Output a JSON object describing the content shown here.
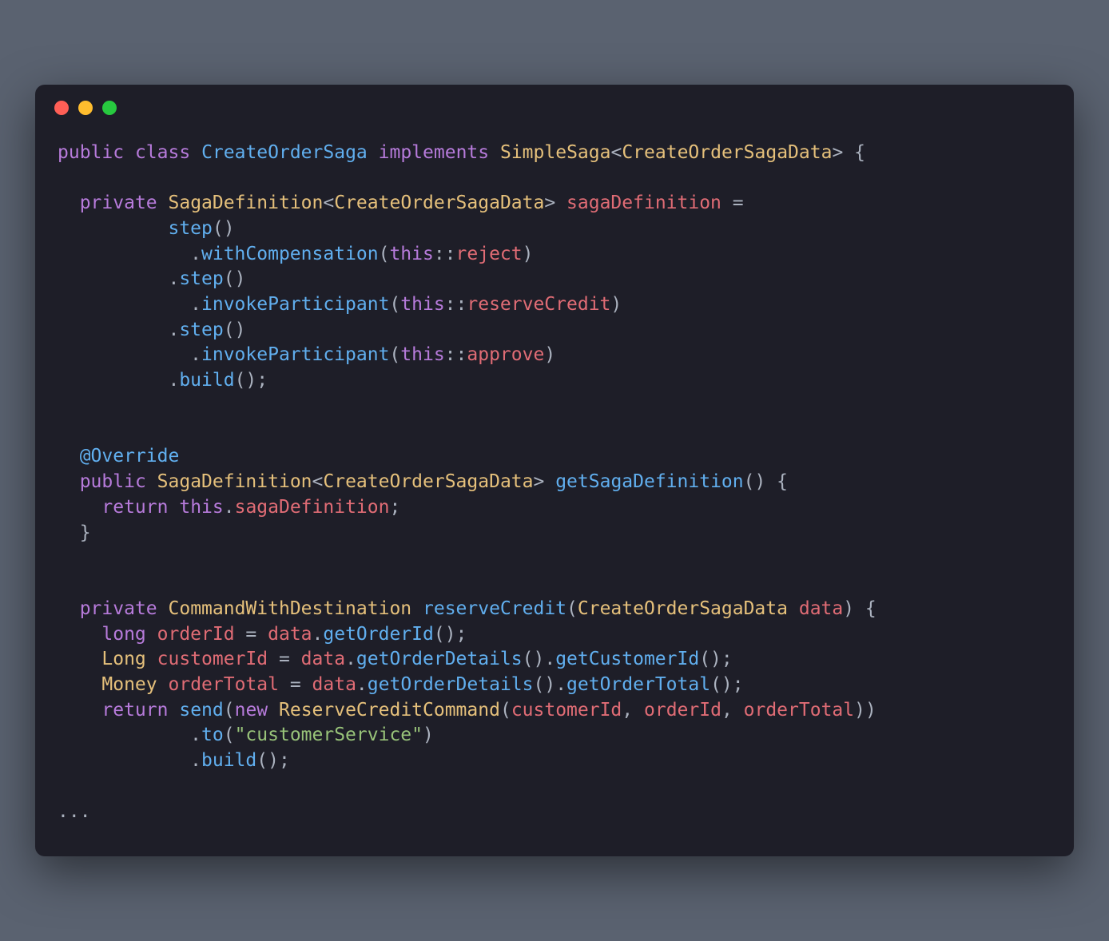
{
  "window": {
    "dots": [
      "red",
      "yellow",
      "green"
    ]
  },
  "code": {
    "tokens": [
      {
        "cls": "kw",
        "t": "public"
      },
      {
        "cls": "punc",
        "t": " "
      },
      {
        "cls": "kw",
        "t": "class"
      },
      {
        "cls": "punc",
        "t": " "
      },
      {
        "cls": "cls",
        "t": "CreateOrderSaga"
      },
      {
        "cls": "punc",
        "t": " "
      },
      {
        "cls": "kw",
        "t": "implements"
      },
      {
        "cls": "punc",
        "t": " "
      },
      {
        "cls": "type",
        "t": "SimpleSaga"
      },
      {
        "cls": "punc",
        "t": "<"
      },
      {
        "cls": "type",
        "t": "CreateOrderSagaData"
      },
      {
        "cls": "punc",
        "t": "> {"
      },
      {
        "cls": "punc",
        "t": "\n"
      },
      {
        "cls": "punc",
        "t": "\n"
      },
      {
        "cls": "punc",
        "t": "  "
      },
      {
        "cls": "kw",
        "t": "private"
      },
      {
        "cls": "punc",
        "t": " "
      },
      {
        "cls": "type",
        "t": "SagaDefinition"
      },
      {
        "cls": "punc",
        "t": "<"
      },
      {
        "cls": "type",
        "t": "CreateOrderSagaData"
      },
      {
        "cls": "punc",
        "t": "> "
      },
      {
        "cls": "var",
        "t": "sagaDefinition"
      },
      {
        "cls": "punc",
        "t": " ="
      },
      {
        "cls": "punc",
        "t": "\n"
      },
      {
        "cls": "punc",
        "t": "          "
      },
      {
        "cls": "method",
        "t": "step"
      },
      {
        "cls": "punc",
        "t": "()"
      },
      {
        "cls": "punc",
        "t": "\n"
      },
      {
        "cls": "punc",
        "t": "            ."
      },
      {
        "cls": "method",
        "t": "withCompensation"
      },
      {
        "cls": "punc",
        "t": "("
      },
      {
        "cls": "thiskw",
        "t": "this"
      },
      {
        "cls": "punc",
        "t": "::"
      },
      {
        "cls": "var",
        "t": "reject"
      },
      {
        "cls": "punc",
        "t": ")"
      },
      {
        "cls": "punc",
        "t": "\n"
      },
      {
        "cls": "punc",
        "t": "          ."
      },
      {
        "cls": "method",
        "t": "step"
      },
      {
        "cls": "punc",
        "t": "()"
      },
      {
        "cls": "punc",
        "t": "\n"
      },
      {
        "cls": "punc",
        "t": "            ."
      },
      {
        "cls": "method",
        "t": "invokeParticipant"
      },
      {
        "cls": "punc",
        "t": "("
      },
      {
        "cls": "thiskw",
        "t": "this"
      },
      {
        "cls": "punc",
        "t": "::"
      },
      {
        "cls": "var",
        "t": "reserveCredit"
      },
      {
        "cls": "punc",
        "t": ")"
      },
      {
        "cls": "punc",
        "t": "\n"
      },
      {
        "cls": "punc",
        "t": "          ."
      },
      {
        "cls": "method",
        "t": "step"
      },
      {
        "cls": "punc",
        "t": "()"
      },
      {
        "cls": "punc",
        "t": "\n"
      },
      {
        "cls": "punc",
        "t": "            ."
      },
      {
        "cls": "method",
        "t": "invokeParticipant"
      },
      {
        "cls": "punc",
        "t": "("
      },
      {
        "cls": "thiskw",
        "t": "this"
      },
      {
        "cls": "punc",
        "t": "::"
      },
      {
        "cls": "var",
        "t": "approve"
      },
      {
        "cls": "punc",
        "t": ")"
      },
      {
        "cls": "punc",
        "t": "\n"
      },
      {
        "cls": "punc",
        "t": "          ."
      },
      {
        "cls": "method",
        "t": "build"
      },
      {
        "cls": "punc",
        "t": "();"
      },
      {
        "cls": "punc",
        "t": "\n"
      },
      {
        "cls": "punc",
        "t": "\n"
      },
      {
        "cls": "punc",
        "t": "\n"
      },
      {
        "cls": "punc",
        "t": "  "
      },
      {
        "cls": "ann",
        "t": "@Override"
      },
      {
        "cls": "punc",
        "t": "\n"
      },
      {
        "cls": "punc",
        "t": "  "
      },
      {
        "cls": "kw",
        "t": "public"
      },
      {
        "cls": "punc",
        "t": " "
      },
      {
        "cls": "type",
        "t": "SagaDefinition"
      },
      {
        "cls": "punc",
        "t": "<"
      },
      {
        "cls": "type",
        "t": "CreateOrderSagaData"
      },
      {
        "cls": "punc",
        "t": "> "
      },
      {
        "cls": "method",
        "t": "getSagaDefinition"
      },
      {
        "cls": "punc",
        "t": "() {"
      },
      {
        "cls": "punc",
        "t": "\n"
      },
      {
        "cls": "punc",
        "t": "    "
      },
      {
        "cls": "kw",
        "t": "return"
      },
      {
        "cls": "punc",
        "t": " "
      },
      {
        "cls": "thiskw",
        "t": "this"
      },
      {
        "cls": "punc",
        "t": "."
      },
      {
        "cls": "var",
        "t": "sagaDefinition"
      },
      {
        "cls": "punc",
        "t": ";"
      },
      {
        "cls": "punc",
        "t": "\n"
      },
      {
        "cls": "punc",
        "t": "  }"
      },
      {
        "cls": "punc",
        "t": "\n"
      },
      {
        "cls": "punc",
        "t": "\n"
      },
      {
        "cls": "punc",
        "t": "\n"
      },
      {
        "cls": "punc",
        "t": "  "
      },
      {
        "cls": "kw",
        "t": "private"
      },
      {
        "cls": "punc",
        "t": " "
      },
      {
        "cls": "type",
        "t": "CommandWithDestination"
      },
      {
        "cls": "punc",
        "t": " "
      },
      {
        "cls": "method",
        "t": "reserveCredit"
      },
      {
        "cls": "punc",
        "t": "("
      },
      {
        "cls": "type",
        "t": "CreateOrderSagaData"
      },
      {
        "cls": "punc",
        "t": " "
      },
      {
        "cls": "var",
        "t": "data"
      },
      {
        "cls": "punc",
        "t": ") {"
      },
      {
        "cls": "punc",
        "t": "\n"
      },
      {
        "cls": "punc",
        "t": "    "
      },
      {
        "cls": "kw",
        "t": "long"
      },
      {
        "cls": "punc",
        "t": " "
      },
      {
        "cls": "var",
        "t": "orderId"
      },
      {
        "cls": "punc",
        "t": " = "
      },
      {
        "cls": "var",
        "t": "data"
      },
      {
        "cls": "punc",
        "t": "."
      },
      {
        "cls": "method",
        "t": "getOrderId"
      },
      {
        "cls": "punc",
        "t": "();"
      },
      {
        "cls": "punc",
        "t": "\n"
      },
      {
        "cls": "punc",
        "t": "    "
      },
      {
        "cls": "type",
        "t": "Long"
      },
      {
        "cls": "punc",
        "t": " "
      },
      {
        "cls": "var",
        "t": "customerId"
      },
      {
        "cls": "punc",
        "t": " = "
      },
      {
        "cls": "var",
        "t": "data"
      },
      {
        "cls": "punc",
        "t": "."
      },
      {
        "cls": "method",
        "t": "getOrderDetails"
      },
      {
        "cls": "punc",
        "t": "()."
      },
      {
        "cls": "method",
        "t": "getCustomerId"
      },
      {
        "cls": "punc",
        "t": "();"
      },
      {
        "cls": "punc",
        "t": "\n"
      },
      {
        "cls": "punc",
        "t": "    "
      },
      {
        "cls": "type",
        "t": "Money"
      },
      {
        "cls": "punc",
        "t": " "
      },
      {
        "cls": "var",
        "t": "orderTotal"
      },
      {
        "cls": "punc",
        "t": " = "
      },
      {
        "cls": "var",
        "t": "data"
      },
      {
        "cls": "punc",
        "t": "."
      },
      {
        "cls": "method",
        "t": "getOrderDetails"
      },
      {
        "cls": "punc",
        "t": "()."
      },
      {
        "cls": "method",
        "t": "getOrderTotal"
      },
      {
        "cls": "punc",
        "t": "();"
      },
      {
        "cls": "punc",
        "t": "\n"
      },
      {
        "cls": "punc",
        "t": "    "
      },
      {
        "cls": "kw",
        "t": "return"
      },
      {
        "cls": "punc",
        "t": " "
      },
      {
        "cls": "method",
        "t": "send"
      },
      {
        "cls": "punc",
        "t": "("
      },
      {
        "cls": "kw",
        "t": "new"
      },
      {
        "cls": "punc",
        "t": " "
      },
      {
        "cls": "type",
        "t": "ReserveCreditCommand"
      },
      {
        "cls": "punc",
        "t": "("
      },
      {
        "cls": "var",
        "t": "customerId"
      },
      {
        "cls": "punc",
        "t": ", "
      },
      {
        "cls": "var",
        "t": "orderId"
      },
      {
        "cls": "punc",
        "t": ", "
      },
      {
        "cls": "var",
        "t": "orderTotal"
      },
      {
        "cls": "punc",
        "t": "))"
      },
      {
        "cls": "punc",
        "t": "\n"
      },
      {
        "cls": "punc",
        "t": "            ."
      },
      {
        "cls": "method",
        "t": "to"
      },
      {
        "cls": "punc",
        "t": "("
      },
      {
        "cls": "str",
        "t": "\"customerService\""
      },
      {
        "cls": "punc",
        "t": ")"
      },
      {
        "cls": "punc",
        "t": "\n"
      },
      {
        "cls": "punc",
        "t": "            ."
      },
      {
        "cls": "method",
        "t": "build"
      },
      {
        "cls": "punc",
        "t": "();"
      },
      {
        "cls": "punc",
        "t": "\n"
      },
      {
        "cls": "punc",
        "t": "\n"
      },
      {
        "cls": "punc",
        "t": "..."
      }
    ]
  }
}
